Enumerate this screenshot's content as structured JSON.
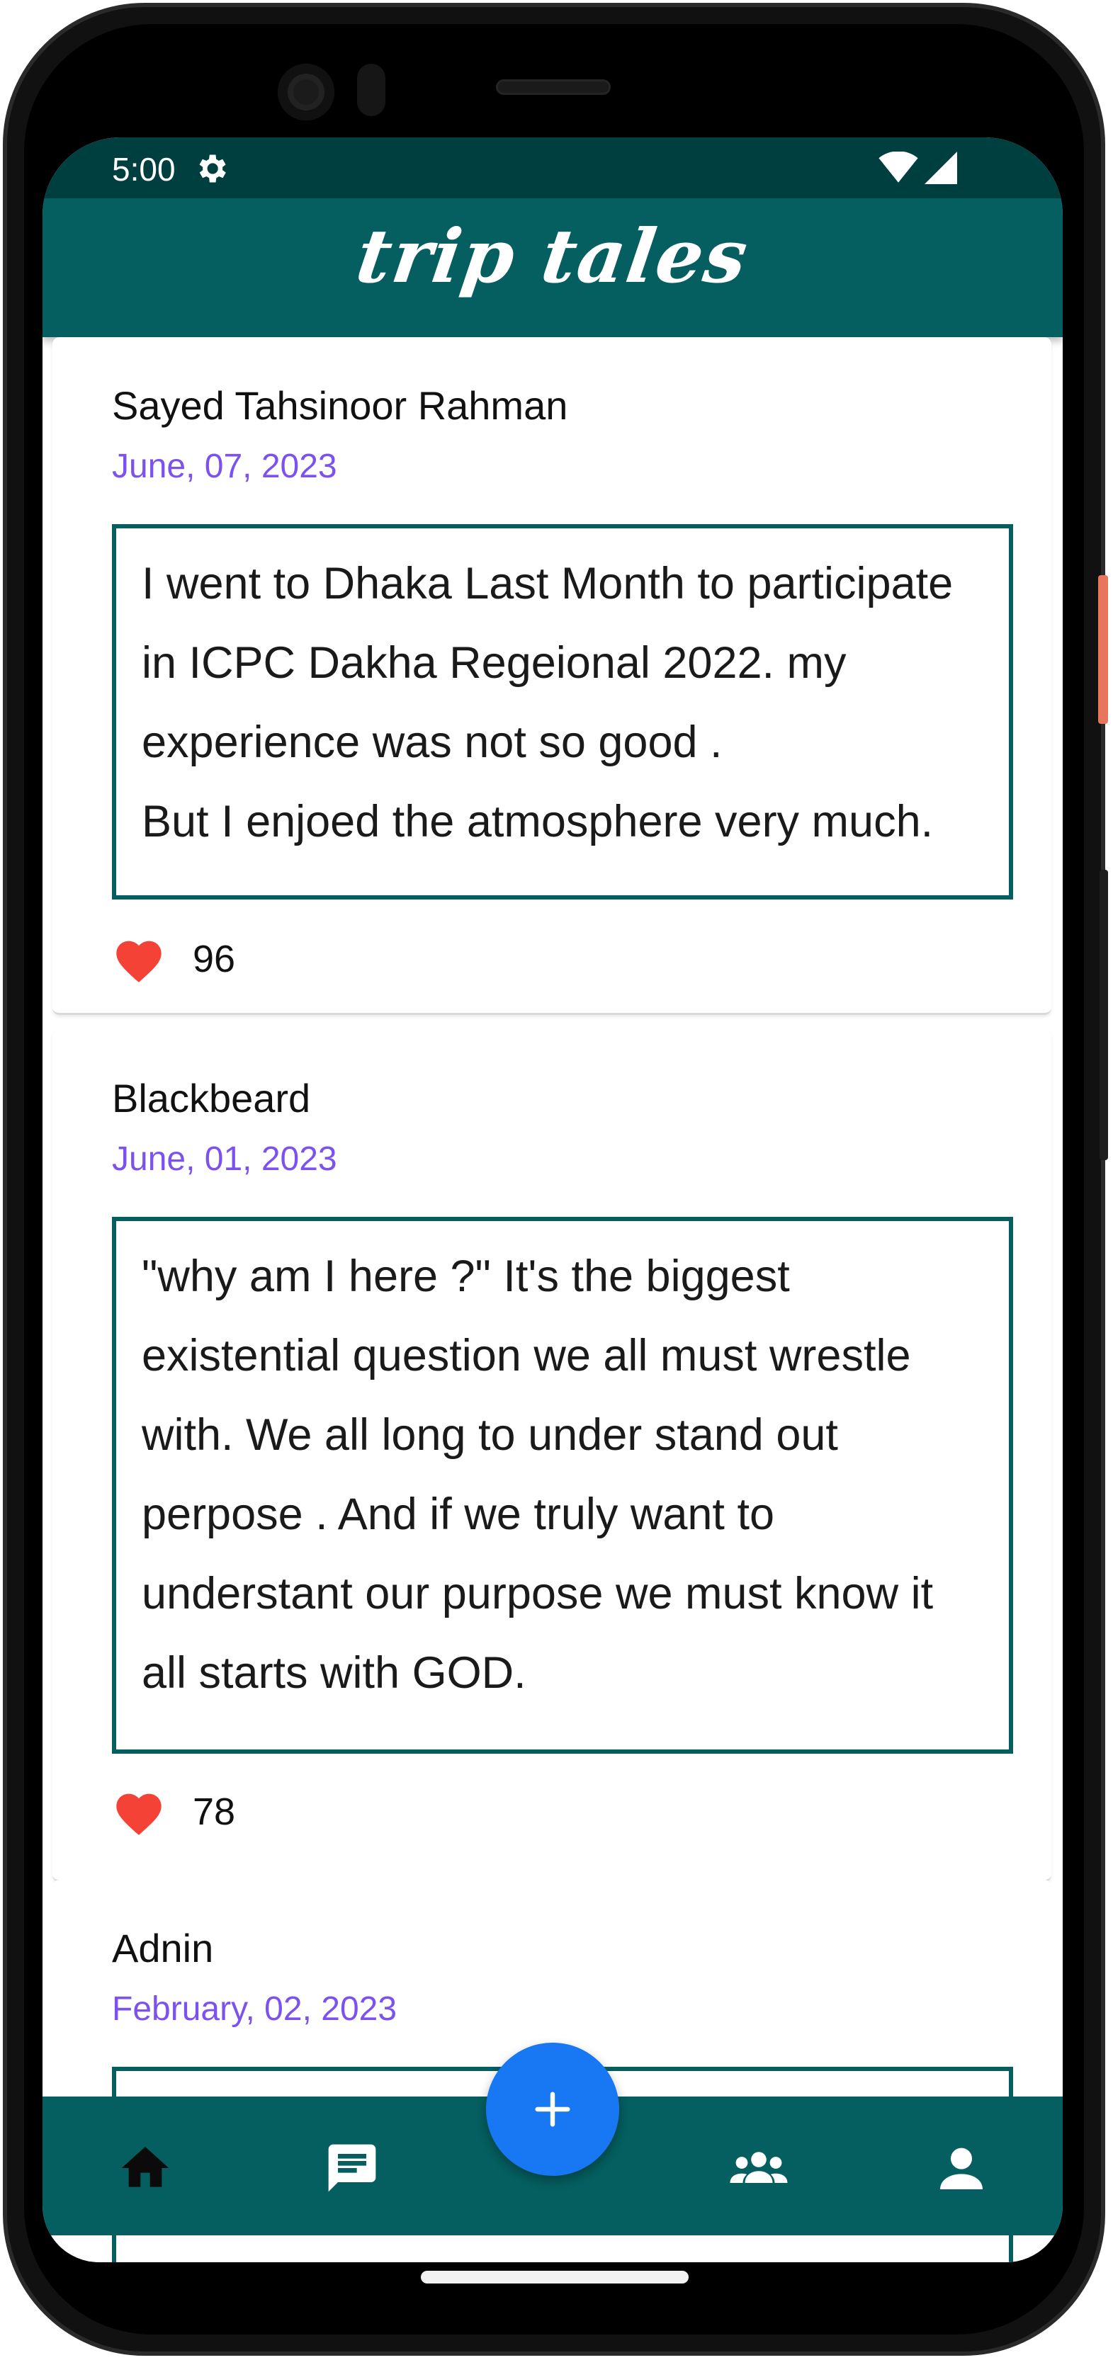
{
  "status_bar": {
    "time": "5:00"
  },
  "app": {
    "title": "trip tales"
  },
  "posts": [
    {
      "author": "Sayed Tahsinoor Rahman",
      "date": "June, 07, 2023",
      "text": "I went to Dhaka Last Month to participate in ICPC Dakha Regeional 2022. my experience was not so good .\nBut I enjoed the atmosphere very much.",
      "likes": "96"
    },
    {
      "author": "Blackbeard",
      "date": "June, 01, 2023",
      "text": "\"why am I here ?\" It's the biggest existential question we all must wrestle with. We all long to under stand out perpose . And if we truly want to understant our purpose we must know it all starts with GOD.",
      "likes": "78"
    },
    {
      "author": "Adnin",
      "date": "February, 02, 2023",
      "text": "",
      "likes": ""
    }
  ],
  "bottom_nav": {
    "items": [
      "home-icon",
      "chat-icon",
      "add-icon",
      "group-icon",
      "profile-icon"
    ]
  },
  "colors": {
    "primary": "#055e5f",
    "status_bar": "#003f3f",
    "date": "#7b52f0",
    "heart": "#f44336",
    "fab": "#1877f2"
  }
}
